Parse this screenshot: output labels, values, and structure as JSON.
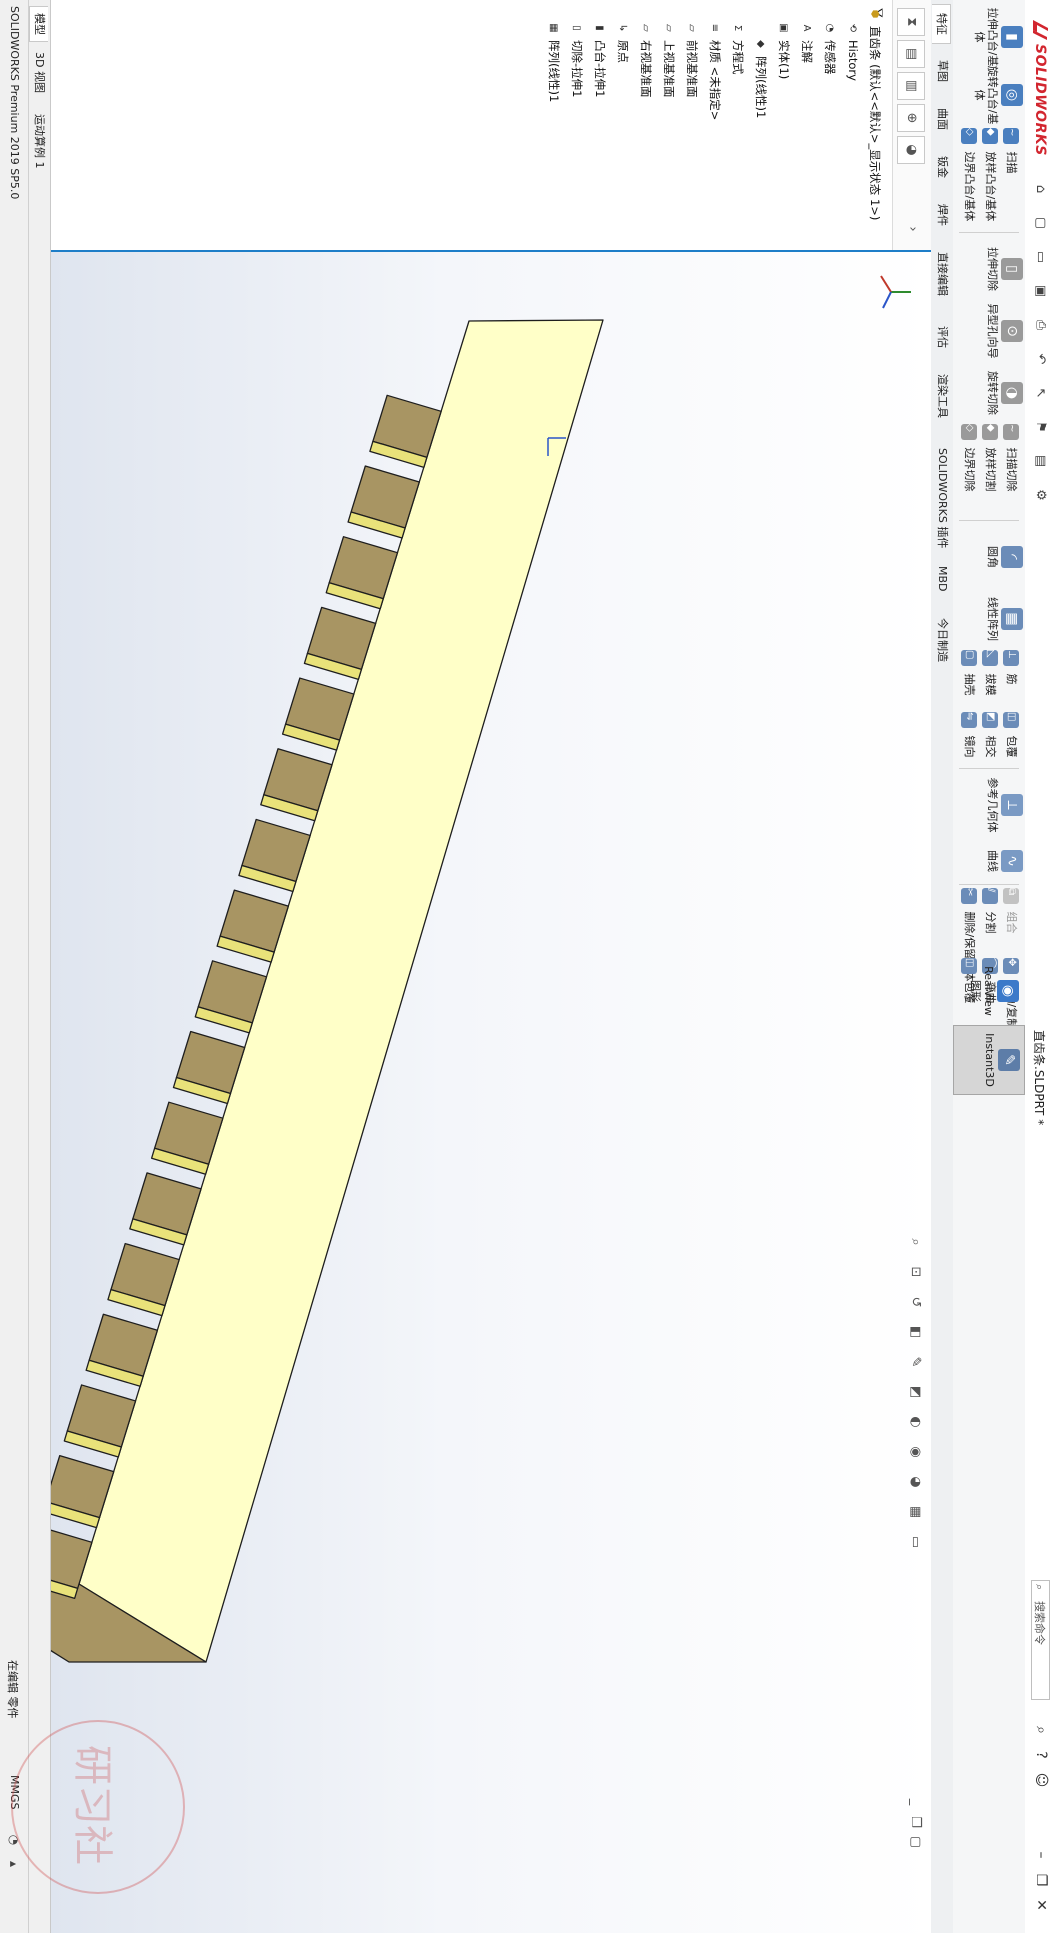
{
  "app": {
    "brand": "SOLIDWORKS",
    "document_title": "直齿条.SLDPRT *",
    "search_placeholder": "搜索命令"
  },
  "quick_access": [
    "home-icon",
    "new-icon",
    "open-icon",
    "save-icon",
    "print-icon",
    "undo-icon",
    "select-icon",
    "rebuild-icon",
    "file-properties-icon",
    "options-icon"
  ],
  "ribbon": {
    "extrude_boss": "拉伸凸台/基体",
    "revolve_boss": "旋转凸台/基体",
    "sweep": "扫描",
    "loft": "放样凸台/基体",
    "boundary_boss": "边界凸台/基体",
    "extrude_cut": "拉伸切除",
    "hole_wizard": "异型孔向导",
    "revolve_cut": "旋转切除",
    "sweep_cut": "扫描切除",
    "loft_cut": "放样切割",
    "boundary_cut": "边界切除",
    "fillet": "圆角",
    "linear_pattern": "线性阵列",
    "rib": "筋",
    "draft": "拔模",
    "shell": "抽壳",
    "wrap": "包覆",
    "intersect": "相交",
    "mirror": "镜向",
    "reference_geometry": "参考几何体",
    "curves": "曲线",
    "combine": "组合",
    "split": "分割",
    "delete_keep_body": "删除/保留实体",
    "move_copy_body": "移动/复制实体",
    "flex": "弯曲",
    "wrap2": "包覆",
    "realview": "RealView 图形",
    "instant3d": "Instant3D"
  },
  "tabs": [
    "特征",
    "草图",
    "曲面",
    "钣金",
    "焊件",
    "直接编辑",
    "评估",
    "渲染工具",
    "SOLIDWORKS 插件",
    "MBD",
    "今日制造"
  ],
  "feature_manager_icons": [
    "feature-tree-icon",
    "property-manager-icon",
    "configuration-manager-icon",
    "dimxpert-icon",
    "display-manager-icon"
  ],
  "tree": {
    "root": "直齿条 (默认<<默认>_显示状态 1>)",
    "items": [
      {
        "label": "History",
        "icon": "history-icon"
      },
      {
        "label": "传感器",
        "icon": "sensor-icon"
      },
      {
        "label": "注解",
        "icon": "annotation-icon"
      },
      {
        "label": "实体(1)",
        "icon": "solid-bodies-icon"
      },
      {
        "label": "阵列(线性)1",
        "icon": "body-icon"
      },
      {
        "label": "方程式",
        "icon": "equations-icon"
      },
      {
        "label": "材质 <未指定>",
        "icon": "material-icon"
      },
      {
        "label": "前视基准面",
        "icon": "plane-icon"
      },
      {
        "label": "上视基准面",
        "icon": "plane-icon"
      },
      {
        "label": "右视基准面",
        "icon": "plane-icon"
      },
      {
        "label": "原点",
        "icon": "origin-icon"
      },
      {
        "label": "凸台-拉伸1",
        "icon": "extrude-icon"
      },
      {
        "label": "切除-拉伸1",
        "icon": "cut-extrude-icon"
      },
      {
        "label": "阵列(线性)1",
        "icon": "linear-pattern-icon"
      }
    ]
  },
  "model": {
    "teeth": 17,
    "top_color": "#ffffc8",
    "side_color": "#a89563",
    "flank_color": "#e9e27a"
  },
  "bottom_tabs": [
    "模型",
    "3D 视图",
    "运动算例 1"
  ],
  "status": {
    "version": "SOLIDWORKS Premium 2019 SP5.0",
    "editing": "在编辑 零件",
    "units": "MMGS"
  },
  "watermark": {
    "text": "研习社"
  }
}
